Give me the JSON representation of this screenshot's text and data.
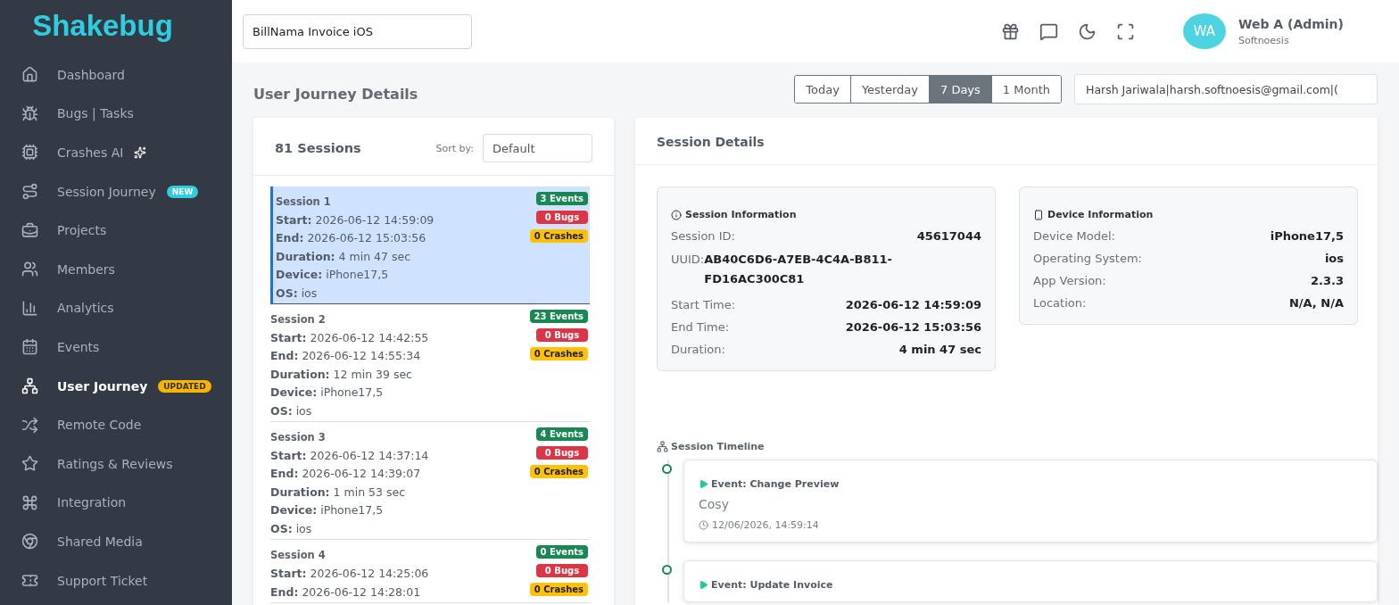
{
  "sidebar": {
    "logo": "Shakebug",
    "items": [
      {
        "label": "Dashboard",
        "selected": false
      },
      {
        "label": "Bugs | Tasks",
        "selected": false
      },
      {
        "label": "Crashes AI",
        "selected": false,
        "sparkle": true
      },
      {
        "label": "Session Journey",
        "selected": false,
        "badge": {
          "text": "NEW",
          "kind": "new"
        }
      },
      {
        "label": "Projects",
        "selected": false
      },
      {
        "label": "Members",
        "selected": false
      },
      {
        "label": "Analytics",
        "selected": false
      },
      {
        "label": "Events",
        "selected": false
      },
      {
        "label": "User Journey",
        "selected": true,
        "badge": {
          "text": "UPDATED",
          "kind": "updated"
        }
      },
      {
        "label": "Remote Code",
        "selected": false
      },
      {
        "label": "Ratings & Reviews",
        "selected": false
      },
      {
        "label": "Integration",
        "selected": false
      },
      {
        "label": "Shared Media",
        "selected": false
      },
      {
        "label": "Support Ticket",
        "selected": false
      }
    ]
  },
  "header": {
    "project": "BillNama Invoice iOS",
    "user": {
      "initials": "WA",
      "name": "Web A (Admin)",
      "company": "Softnoesis"
    }
  },
  "page_title": "User Journey Details",
  "ranges": [
    {
      "label": "Today",
      "selected": false
    },
    {
      "label": "Yesterday",
      "selected": false
    },
    {
      "label": "7 Days",
      "selected": true
    },
    {
      "label": "1 Month",
      "selected": false
    }
  ],
  "user_filter": "Harsh Jariwala|harsh.softnoesis@gmail.com|(",
  "sessions_panel": {
    "count": "81 Sessions",
    "sort_label": "Sort by:",
    "sort_value": "Default",
    "sessions": [
      {
        "title": "Session 1",
        "selected": true,
        "fields": [
          {
            "label": "Start:",
            "value": "2026-06-12 14:59:09"
          },
          {
            "label": "End:",
            "value": "2026-06-12 15:03:56"
          },
          {
            "label": "Duration:",
            "value": "4 min 47 sec"
          },
          {
            "label": "Device:",
            "value": "iPhone17,5"
          },
          {
            "label": "OS:",
            "value": "ios"
          }
        ],
        "badges": [
          {
            "kind": "events",
            "text": "3 Events"
          },
          {
            "kind": "bugs",
            "text": "0 Bugs"
          },
          {
            "kind": "crashes",
            "text": "0 Crashes"
          }
        ]
      },
      {
        "title": "Session 2",
        "selected": false,
        "fields": [
          {
            "label": "Start:",
            "value": "2026-06-12 14:42:55"
          },
          {
            "label": "End:",
            "value": "2026-06-12 14:55:34"
          },
          {
            "label": "Duration:",
            "value": "12 min 39 sec"
          },
          {
            "label": "Device:",
            "value": "iPhone17,5"
          },
          {
            "label": "OS:",
            "value": "ios"
          }
        ],
        "badges": [
          {
            "kind": "events",
            "text": "23 Events"
          },
          {
            "kind": "bugs",
            "text": "0 Bugs"
          },
          {
            "kind": "crashes",
            "text": "0 Crashes"
          }
        ]
      },
      {
        "title": "Session 3",
        "selected": false,
        "fields": [
          {
            "label": "Start:",
            "value": "2026-06-12 14:37:14"
          },
          {
            "label": "End:",
            "value": "2026-06-12 14:39:07"
          },
          {
            "label": "Duration:",
            "value": "1 min 53 sec"
          },
          {
            "label": "Device:",
            "value": "iPhone17,5"
          },
          {
            "label": "OS:",
            "value": "ios"
          }
        ],
        "badges": [
          {
            "kind": "events",
            "text": "4 Events"
          },
          {
            "kind": "bugs",
            "text": "0 Bugs"
          },
          {
            "kind": "crashes",
            "text": "0 Crashes"
          }
        ]
      },
      {
        "title": "Session 4",
        "selected": false,
        "fields": [
          {
            "label": "Start:",
            "value": "2026-06-12 14:25:06"
          },
          {
            "label": "End:",
            "value": "2026-06-12 14:28:01"
          }
        ],
        "badges": [
          {
            "kind": "events",
            "text": "0 Events"
          },
          {
            "kind": "bugs",
            "text": "0 Bugs"
          },
          {
            "kind": "crashes",
            "text": "0 Crashes"
          }
        ]
      }
    ]
  },
  "details": {
    "title": "Session Details",
    "session_info": {
      "title": "Session Information",
      "rows": [
        {
          "kind": "split",
          "label": "Session ID:",
          "value": "45617044"
        },
        {
          "kind": "inline",
          "label": "UUID:",
          "value": "AB40C6D6-A7EB-4C4A-B811-FD16AC300C81"
        },
        {
          "kind": "split",
          "label": "Start Time:",
          "value": "2026-06-12 14:59:09"
        },
        {
          "kind": "split",
          "label": "End Time:",
          "value": "2026-06-12 15:03:56"
        },
        {
          "kind": "split",
          "label": "Duration:",
          "value": "4 min 47 sec"
        }
      ]
    },
    "device_info": {
      "title": "Device Information",
      "rows": [
        {
          "kind": "split",
          "label": "Device Model:",
          "value": "iPhone17,5"
        },
        {
          "kind": "split",
          "label": "Operating System:",
          "value": "ios"
        },
        {
          "kind": "split",
          "label": "App Version:",
          "value": "2.3.3"
        },
        {
          "kind": "split",
          "label": "Location:",
          "value": "N/A, N/A"
        }
      ]
    },
    "timeline": {
      "title": "Session Timeline",
      "events": [
        {
          "title": "Event: Change Preview",
          "detail": "Cosy",
          "time": "12/06/2026, 14:59:14"
        },
        {
          "title": "Event: Update Invoice"
        }
      ]
    }
  }
}
